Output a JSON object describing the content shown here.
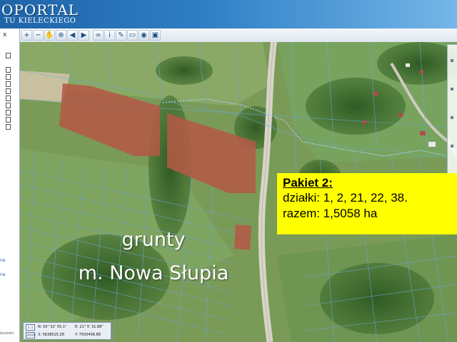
{
  "header": {
    "logo_main": "OPORTAL",
    "logo_sub": "TU KIELECKIEGO"
  },
  "toolbar": {
    "icons": [
      "zoom-in-icon",
      "zoom-out-icon",
      "pan-hand-icon",
      "zoom-extent-icon",
      "back-arrow-icon",
      "forward-arrow-icon",
      "link-icon",
      "info-icon",
      "measure-icon",
      "scale-bar-icon",
      "globe-icon",
      "camera-icon"
    ]
  },
  "left_panel": {
    "close": "x",
    "tag_1": "na",
    "tag_2": "na",
    "footer": "łyszości"
  },
  "info_box": {
    "title": "Pakiet 2:",
    "parcels": "działki: 1, 2, 21, 22, 38.",
    "total": "razem: 1,5058 ha"
  },
  "land_text": {
    "line1": "grunty",
    "line2": "m. Nowa Słupia"
  },
  "coords": {
    "btn_top": "1:1",
    "btn_bottom": "2000",
    "lat": "N: 50° 52' 55.1\"",
    "lon": "E: 21° 5' 31.88\"",
    "x": "X: 5638525.28",
    "y": "Y: 7500406.88"
  },
  "colors": {
    "parcel_highlight": "#b35a45",
    "info_box_bg": "#ffff00",
    "header_blue": "#2f7fc6"
  }
}
